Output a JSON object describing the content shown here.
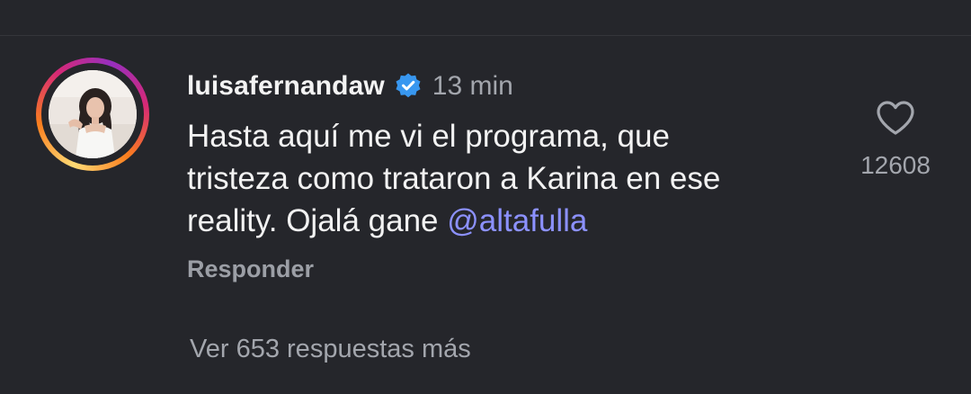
{
  "comment": {
    "username": "luisafernandaw",
    "verified": true,
    "timestamp": "13 min",
    "text_lines": [
      "Hasta aquí me vi el programa, que",
      "tristeza como trataron a Karina en ese",
      "reality. Ojalá gane "
    ],
    "mention": "@altafulla",
    "reply_label": "Responder",
    "like_count": "12608"
  },
  "replies": {
    "more_label": "Ver 653 respuestas más"
  },
  "icons": {
    "like": "heart-outline-icon",
    "verified": "verified-badge-icon"
  },
  "colors": {
    "background": "#25262b",
    "mention": "#8c91ff",
    "verified": "#3897f0",
    "secondary_text": "#a3a6ad"
  }
}
